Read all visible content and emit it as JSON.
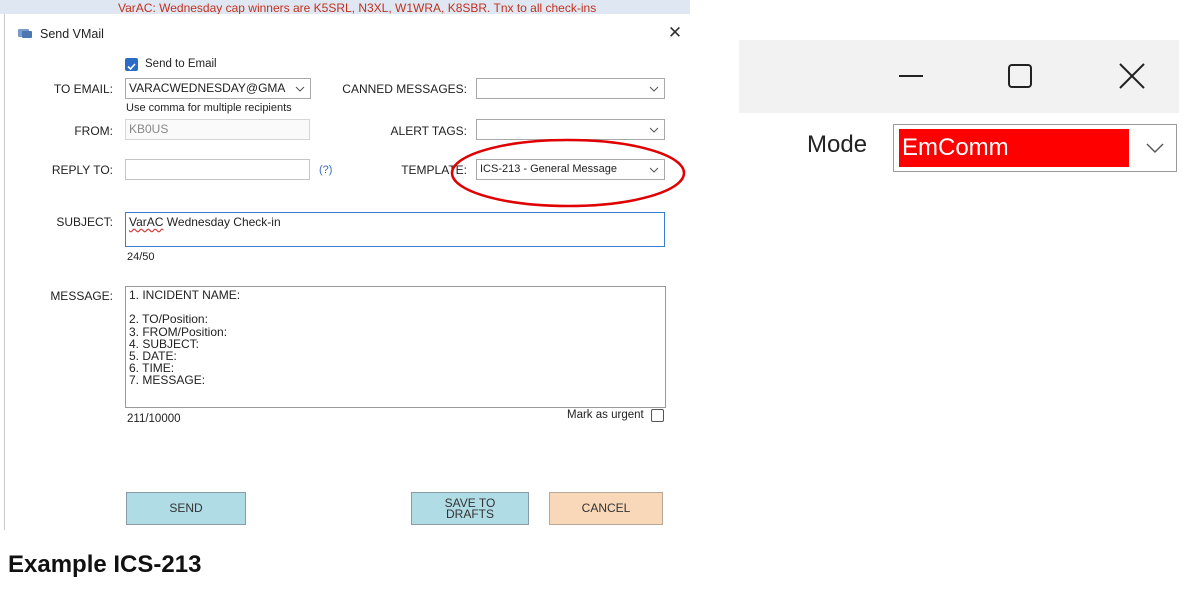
{
  "background_banner": "VarAC: Wednesday cap winners are K5SRL, N3XL, W1WRA, K8SBR. Tnx to all check-ins",
  "window": {
    "title": "Send VMail"
  },
  "form": {
    "send_to_email_label": "Send to Email",
    "send_to_email_checked": true,
    "to_email_label": "TO EMAIL:",
    "to_email_value": "VARACWEDNESDAY@GMA",
    "to_email_hint": "Use comma for multiple recipients",
    "from_label": "FROM:",
    "from_value": "KB0US",
    "reply_to_label": "REPLY TO:",
    "reply_to_value": "",
    "reply_help": "(?)",
    "canned_label": "CANNED MESSAGES:",
    "canned_value": "",
    "alert_tags_label": "ALERT TAGS:",
    "alert_tags_value": "",
    "template_label": "TEMPLATE:",
    "template_value": "ICS-213 - General Message",
    "subject_label": "SUBJECT:",
    "subject_first": "VarAC",
    "subject_rest": " Wednesday Check-in",
    "subject_count": "24/50",
    "message_label": "MESSAGE:",
    "message_lines": [
      "1. INCIDENT NAME:",
      "",
      "2. TO/Position:",
      "3. FROM/Position:",
      "4. SUBJECT:",
      "5. DATE:",
      "6. TIME:",
      "7. MESSAGE:"
    ],
    "message_count": "211/10000",
    "urgent_label": "Mark as urgent",
    "urgent_checked": false
  },
  "buttons": {
    "send": "SEND",
    "save_line1": "SAVE TO",
    "save_line2": "DRAFTS",
    "cancel": "CANCEL"
  },
  "mode": {
    "label": "Mode",
    "value": "EmComm",
    "highlight_color": "#ff0000"
  },
  "caption": "Example ICS-213",
  "colors": {
    "blue_button": "#b0dce6",
    "peach_button": "#f8d8b8",
    "annotation_circle": "#e00000",
    "checkbox_blue": "#2b6cc4"
  },
  "icons": {
    "app": "vmail-icon",
    "close": "close-icon",
    "dropdown": "chevron-down-icon",
    "minimize": "minimize-icon",
    "maximize": "maximize-icon",
    "window_close": "close-icon"
  }
}
